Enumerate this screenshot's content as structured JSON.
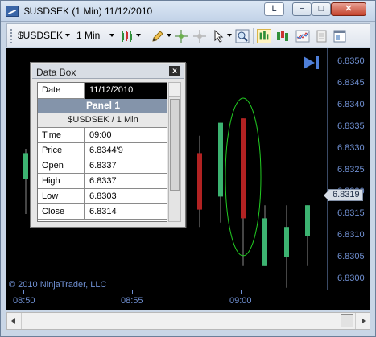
{
  "window": {
    "title": "$USDSEK (1 Min)  11/12/2010",
    "link_button_label": "L",
    "minimize_label": "−",
    "maximize_label": "□",
    "close_label": "✕"
  },
  "toolbar": {
    "instrument": "$USDSEK",
    "interval": "1 Min",
    "icons": [
      "bar-type-icon",
      "pencil-drawing-icon",
      "crosshair-icon",
      "global-crosshair-icon",
      "cursor-icon",
      "zoom-icon",
      "chart-style-icon",
      "indicators-icon",
      "strategies-icon",
      "properties-icon",
      "data-box-icon"
    ]
  },
  "chart": {
    "background": "#000000",
    "axis_color": "#6f8fd1",
    "up_color": "#3cb371",
    "down_color": "#b22222",
    "ellipse_color": "#22cc22",
    "current_price": "6.8319",
    "copyright": "© 2010 NinjaTrader, LLC",
    "price_ticks": [
      "6.8350",
      "6.8345",
      "6.8340",
      "6.8335",
      "6.8330",
      "6.8325",
      "6.8320",
      "6.8315",
      "6.8310",
      "6.8305",
      "6.8300"
    ],
    "time_ticks": [
      "08:50",
      "08:55",
      "09:00"
    ]
  },
  "chart_data": {
    "type": "candlestick",
    "xlabel": "",
    "ylabel": "",
    "ylim": [
      6.8297,
      6.8354
    ],
    "candles": [
      {
        "open": 6.8323,
        "high": 6.833,
        "low": 6.8315,
        "close": 6.8329
      },
      {
        "open": 6.8329,
        "high": 6.8333,
        "low": 6.8312,
        "close": 6.8316
      },
      {
        "open": 6.8316,
        "high": 6.8322,
        "low": 6.8312,
        "close": 6.832
      },
      {
        "open": 6.8319,
        "high": 6.8336,
        "low": 6.8313,
        "close": 6.8336
      },
      {
        "open": 6.8337,
        "high": 6.8337,
        "low": 6.8303,
        "close": 6.8314
      },
      {
        "open": 6.8303,
        "high": 6.8317,
        "low": 6.8303,
        "close": 6.8314
      },
      {
        "open": 6.8305,
        "high": 6.8317,
        "low": 6.8298,
        "close": 6.8312
      },
      {
        "open": 6.831,
        "high": 6.8317,
        "low": 6.8303,
        "close": 6.8317
      },
      {
        "open": 6.8304,
        "high": 6.8319,
        "low": 6.8301,
        "close": 6.8318
      }
    ]
  },
  "databox": {
    "title": "Data Box",
    "close_label": "x",
    "date_label": "Date",
    "date_value": "11/12/2010",
    "panel_label": "Panel 1",
    "series_label": "$USDSEK / 1 Min",
    "rows": [
      {
        "label": "Time",
        "value": "09:00"
      },
      {
        "label": "Price",
        "value": "6.8344'9"
      },
      {
        "label": "Open",
        "value": "6.8337"
      },
      {
        "label": "High",
        "value": "6.8337"
      },
      {
        "label": "Low",
        "value": "6.8303"
      },
      {
        "label": "Close",
        "value": "6.8314"
      }
    ]
  }
}
